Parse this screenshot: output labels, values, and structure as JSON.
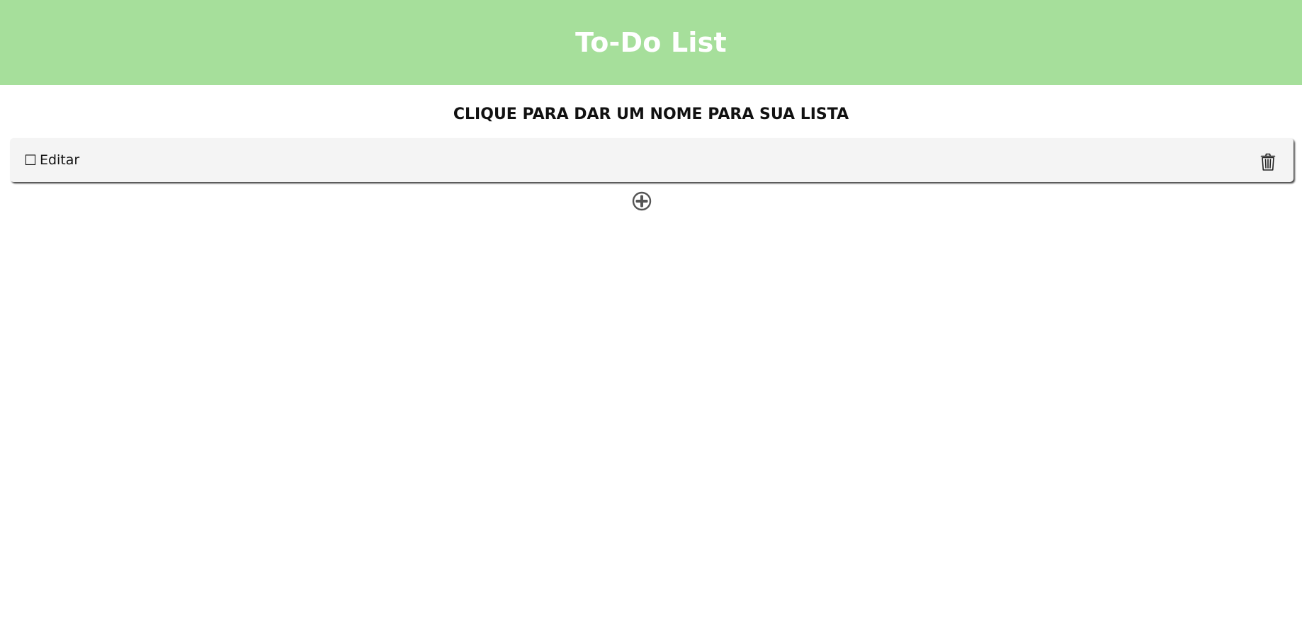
{
  "header": {
    "title": "To-Do List",
    "background": "#a6df9b"
  },
  "list": {
    "title": "CLIQUE PARA DAR UM NOME PARA SUA LISTA"
  },
  "tasks": [
    {
      "checkbox": "☐",
      "text": "Editar",
      "delete_icon": "trash-icon"
    }
  ],
  "add": {
    "icon": "plus-circle-icon"
  }
}
